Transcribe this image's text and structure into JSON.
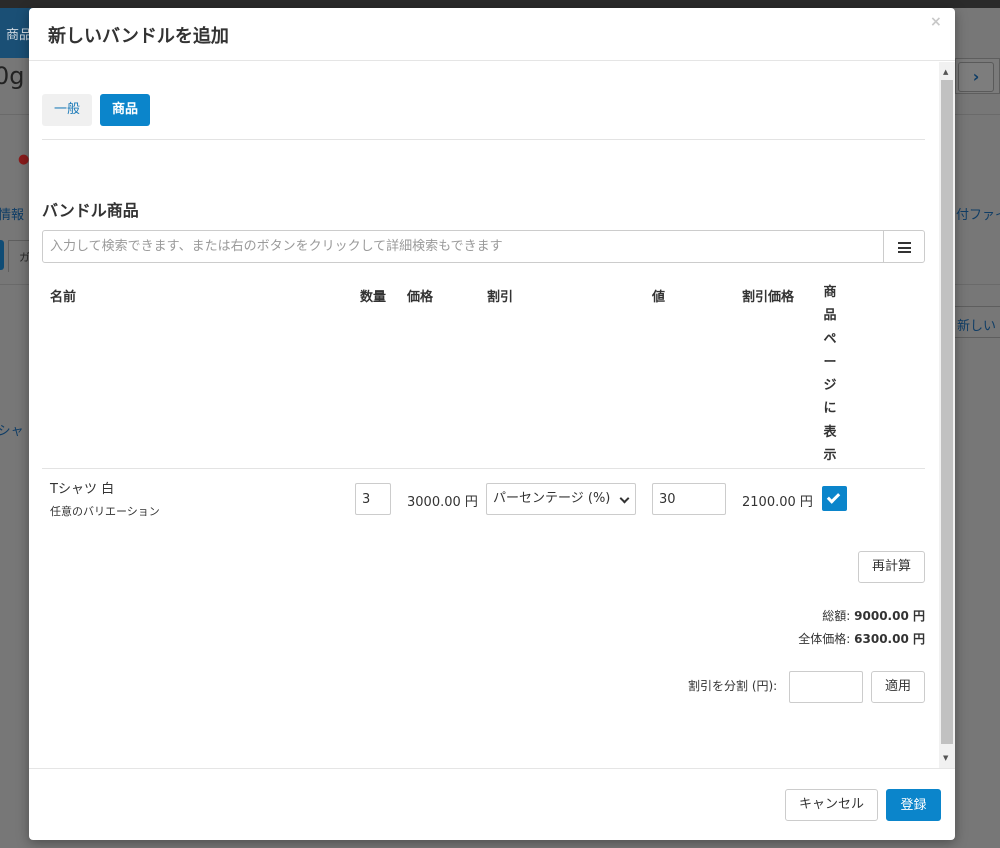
{
  "background": {
    "tab_label": "商品",
    "headline": "0g ...",
    "nav_arrow": "›",
    "left_label_1": "情報",
    "right_label_1": "付ファイ",
    "left_tab_char": "ガ",
    "right_button": "新しい",
    "left_label_2": "'シャ"
  },
  "modal": {
    "title": "新しいバンドルを追加",
    "close_glyph": "×",
    "tabs": [
      {
        "label": "一般",
        "active": false
      },
      {
        "label": "商品",
        "active": true
      }
    ],
    "section_title": "バンドル商品",
    "search": {
      "placeholder": "入力して検索できます、または右のボタンをクリックして詳細検索もできます",
      "value": ""
    },
    "table": {
      "headers": {
        "name": "名前",
        "quantity": "数量",
        "price": "価格",
        "discount": "割引",
        "value": "値",
        "discount_price": "割引価格",
        "show_on_product_page": "商品ページに表示"
      },
      "rows": [
        {
          "name": "Tシャツ 白",
          "variant": "任意のバリエーション",
          "quantity": "3",
          "price": "3000.00 円",
          "discount_type": "パーセンテージ (%)",
          "value": "30",
          "discount_price": "2100.00 円",
          "show": true
        }
      ]
    },
    "recalculate_label": "再計算",
    "totals": {
      "total_label": "総額: ",
      "total_value": "9000.00 円",
      "overall_label": "全体価格: ",
      "overall_value": "6300.00 円"
    },
    "split": {
      "label": "割引を分割 (円):",
      "value": "",
      "apply_label": "適用"
    },
    "footer": {
      "cancel_label": "キャンセル",
      "save_label": "登録"
    }
  },
  "colors": {
    "primary": "#0b85cb",
    "overlay": "#777777"
  }
}
